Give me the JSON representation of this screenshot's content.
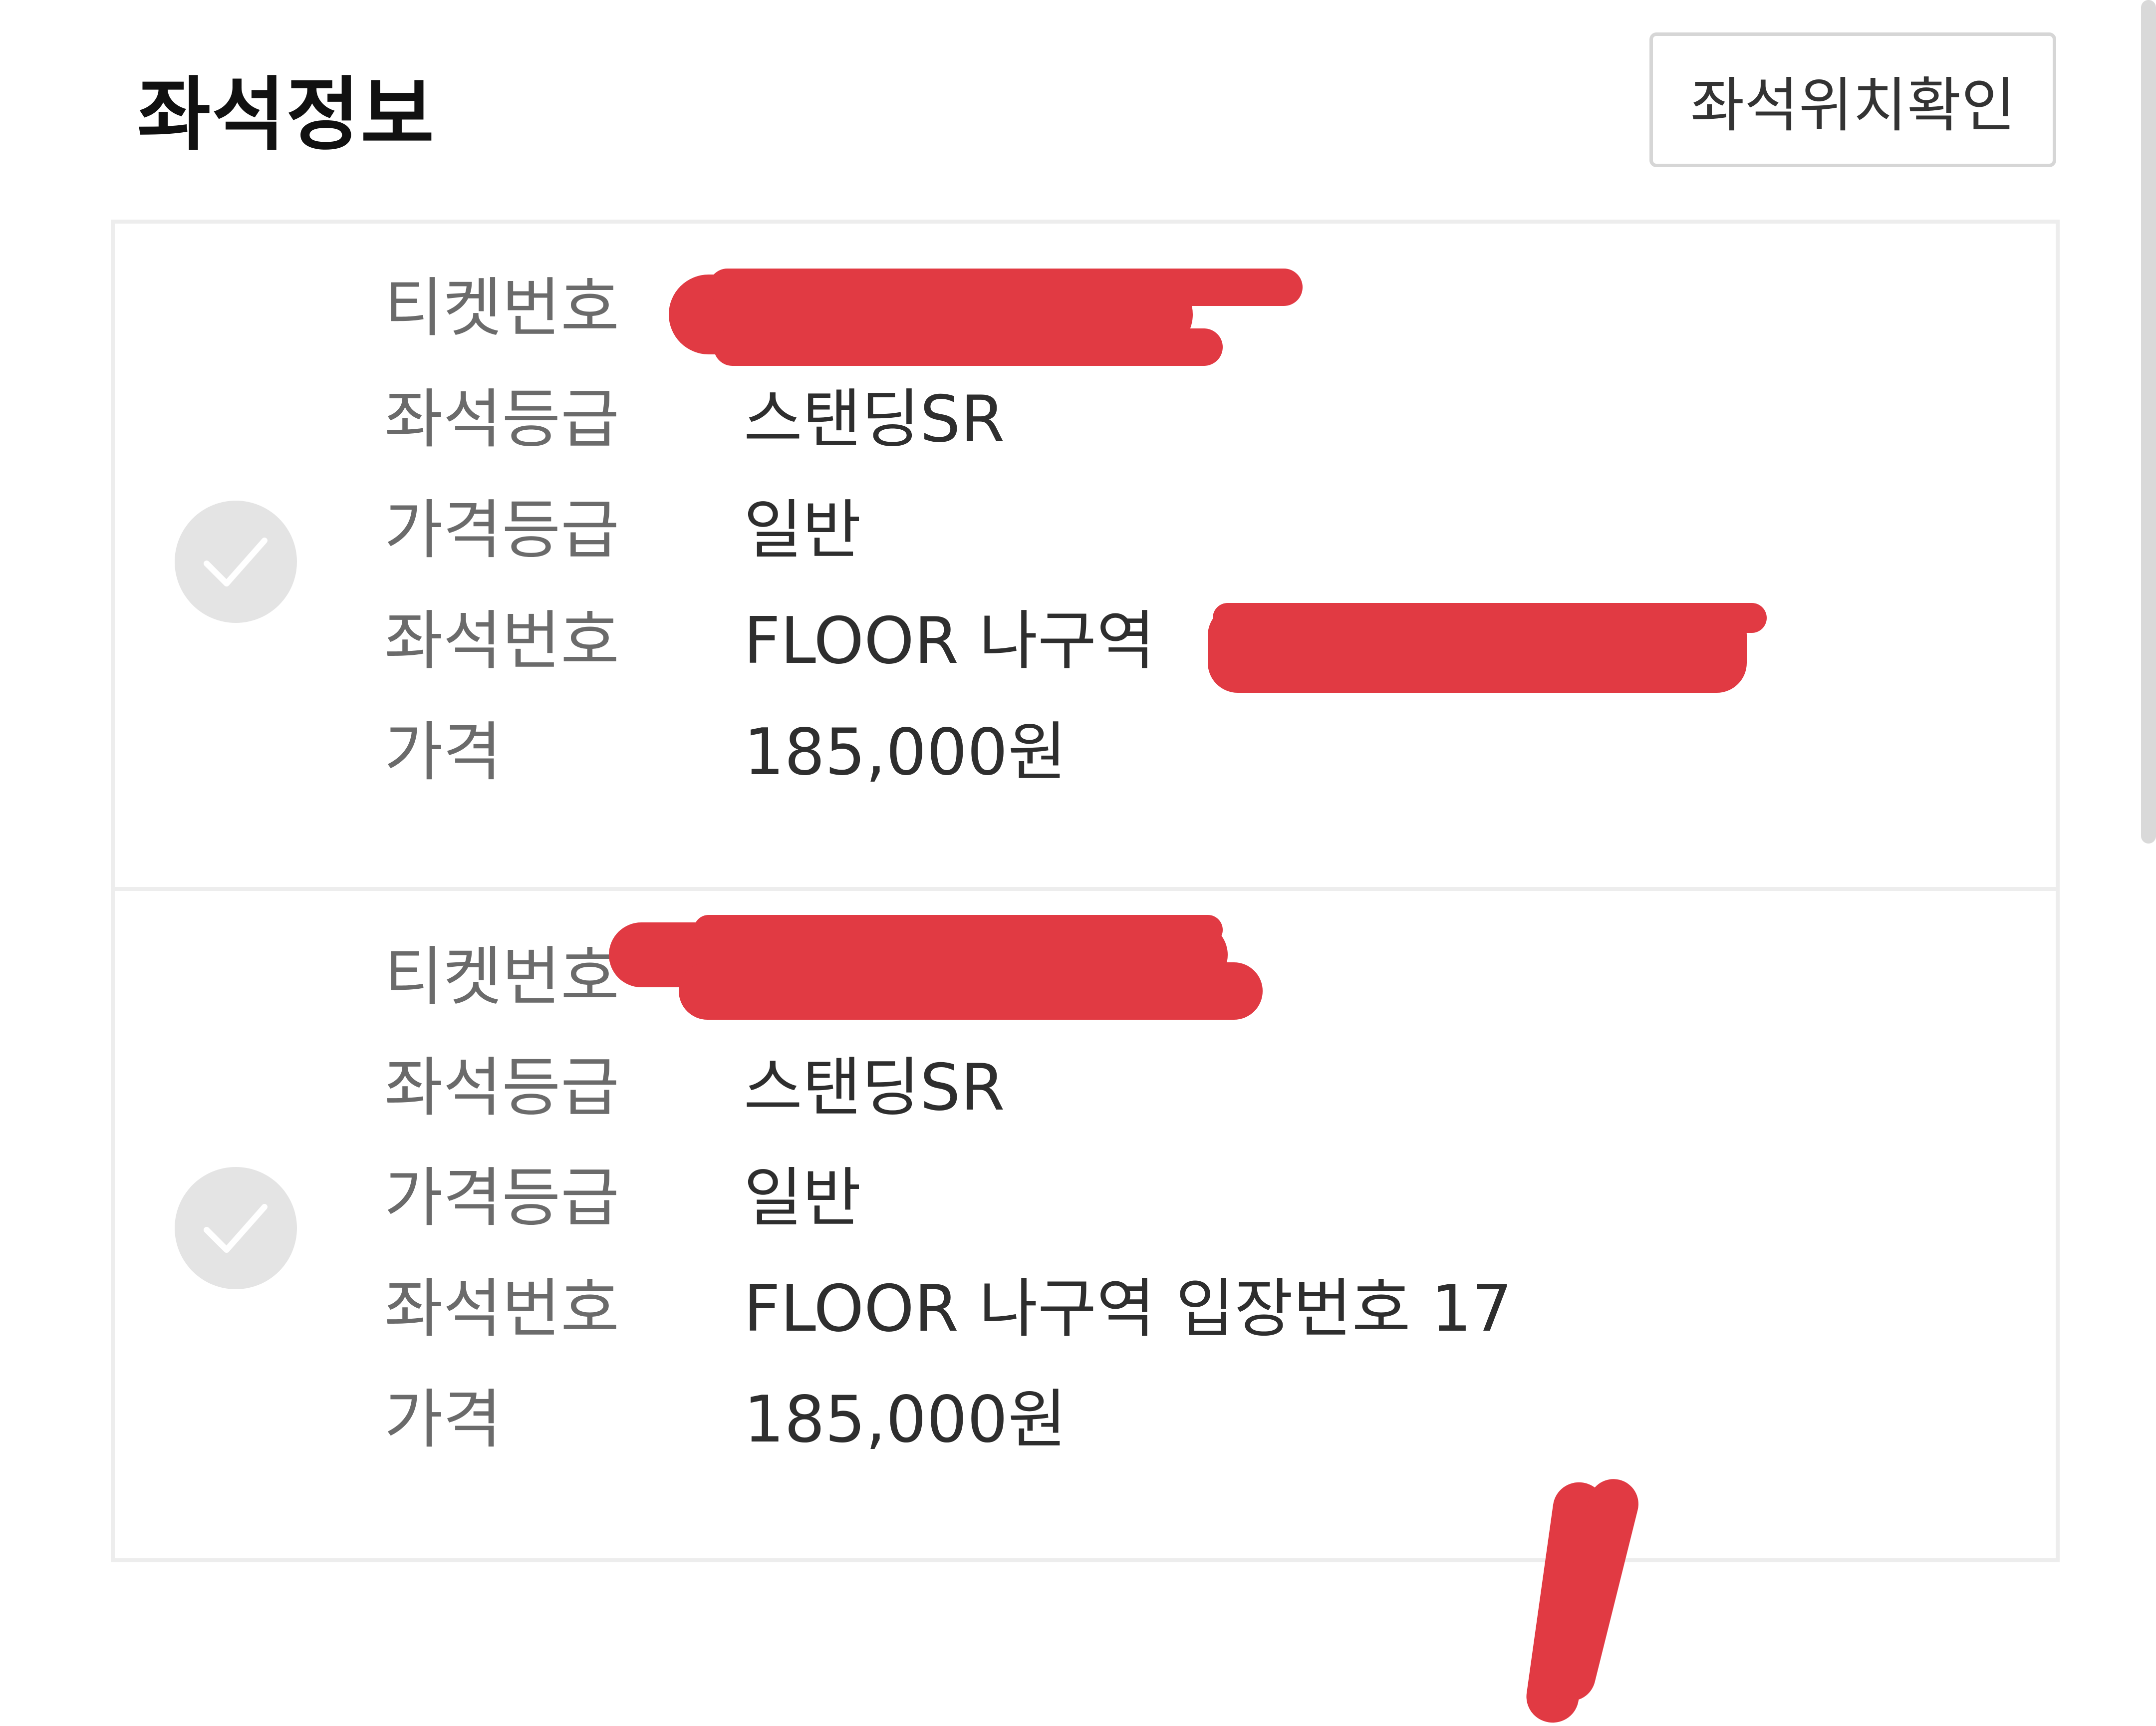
{
  "header": {
    "title": "좌석정보",
    "seat_location_button": "좌석위치확인"
  },
  "tickets": [
    {
      "fields": [
        {
          "label": "티켓번호",
          "value": ""
        },
        {
          "label": "좌석등급",
          "value": "스탠딩SR"
        },
        {
          "label": "가격등급",
          "value": "일반"
        },
        {
          "label": "좌석번호",
          "value": "FLOOR 나구역"
        },
        {
          "label": "가격",
          "value": "185,000원"
        }
      ]
    },
    {
      "fields": [
        {
          "label": "티켓번호",
          "value": ""
        },
        {
          "label": "좌석등급",
          "value": "스탠딩SR"
        },
        {
          "label": "가격등급",
          "value": "일반"
        },
        {
          "label": "좌석번호",
          "value": "FLOOR 나구역 입장번호 17"
        },
        {
          "label": "가격",
          "value": "185,000원"
        }
      ]
    }
  ],
  "icons": {
    "check": "check-circle-icon"
  },
  "colors": {
    "redaction": "#e13a43",
    "check_circle": "#e4e4e4",
    "border": "#ededed"
  }
}
